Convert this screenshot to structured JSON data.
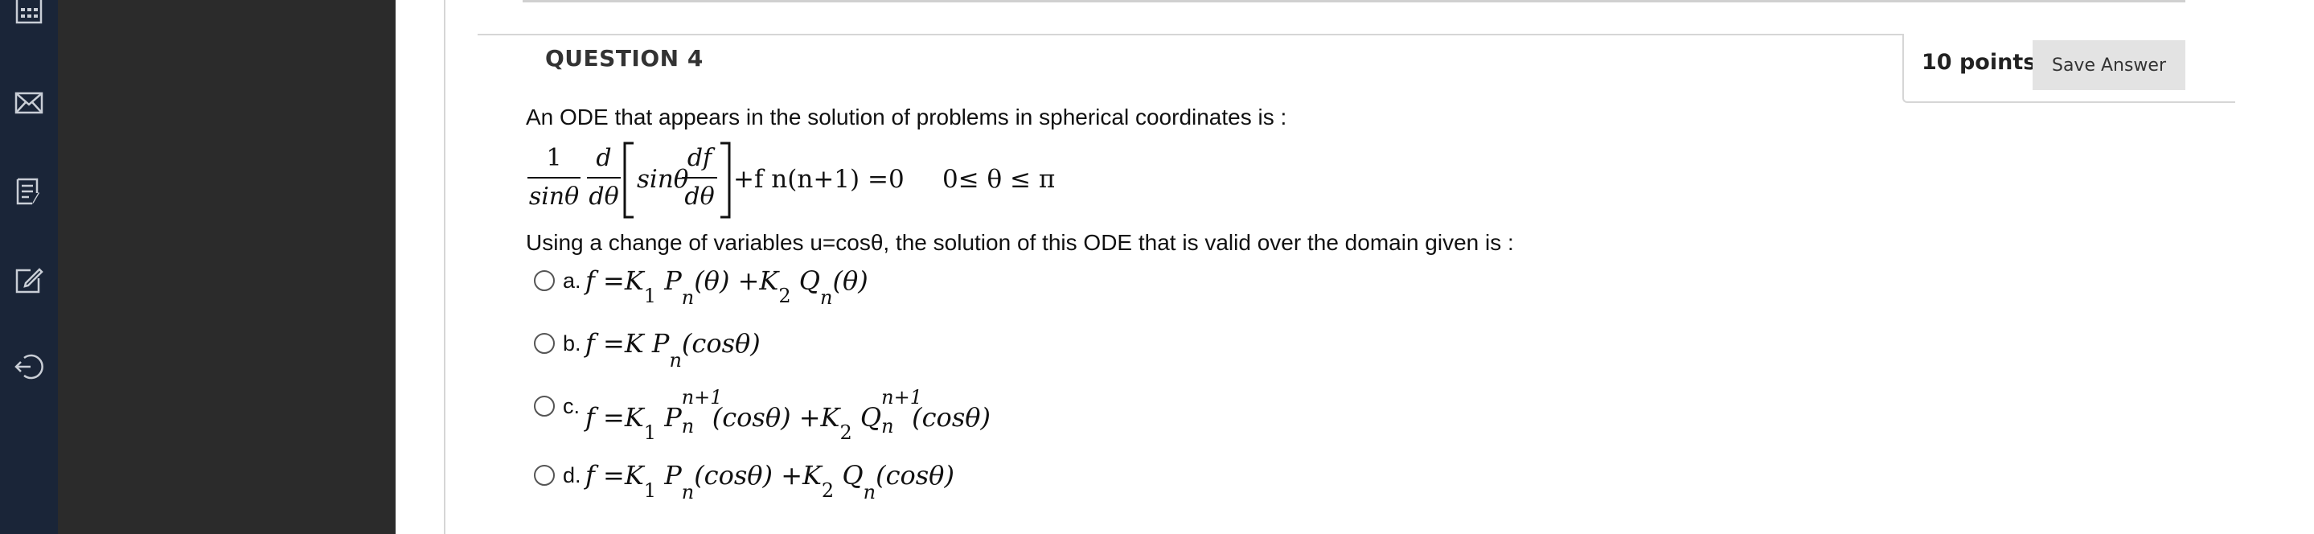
{
  "nav": {
    "icons": [
      "calendar-icon",
      "mail-icon",
      "grades-icon",
      "edit-icon",
      "logout-icon"
    ]
  },
  "question": {
    "title": "QUESTION 4",
    "points": "10 points",
    "save_label": "Save Answer",
    "intro": "An ODE that appears in the solution of problems in spherical coordinates is :",
    "instruction": "Using a change of variables u=cosθ, the solution of this ODE that is valid over the domain given is :"
  },
  "equation": {
    "frac1_num": "1",
    "frac1_den": "sinθ",
    "frac2_num": "d",
    "frac2_den": "dθ",
    "sin_term": "sinθ",
    "frac3_num": "df",
    "frac3_den": "dθ",
    "rest": "+f n(n+1) =0",
    "domain": "0≤ θ ≤ π"
  },
  "options": [
    {
      "letter": "a.",
      "parts": [
        "f =K",
        "1",
        "P",
        "n",
        "(θ) +K",
        "2",
        "Q",
        "n",
        "(θ)"
      ]
    },
    {
      "letter": "b.",
      "parts": [
        "f =K P",
        "n",
        "(cosθ)"
      ]
    },
    {
      "letter": "c.",
      "parts": [
        "f =K",
        "1",
        "P",
        "n+1",
        "n",
        "(cosθ) +K",
        "2",
        "Q",
        "n+1",
        "n",
        "(cosθ)"
      ]
    },
    {
      "letter": "d.",
      "parts": [
        "f =K",
        "1",
        "P",
        "n",
        "(cosθ) +K",
        "2",
        "Q",
        "n",
        "(cosθ)"
      ]
    }
  ]
}
